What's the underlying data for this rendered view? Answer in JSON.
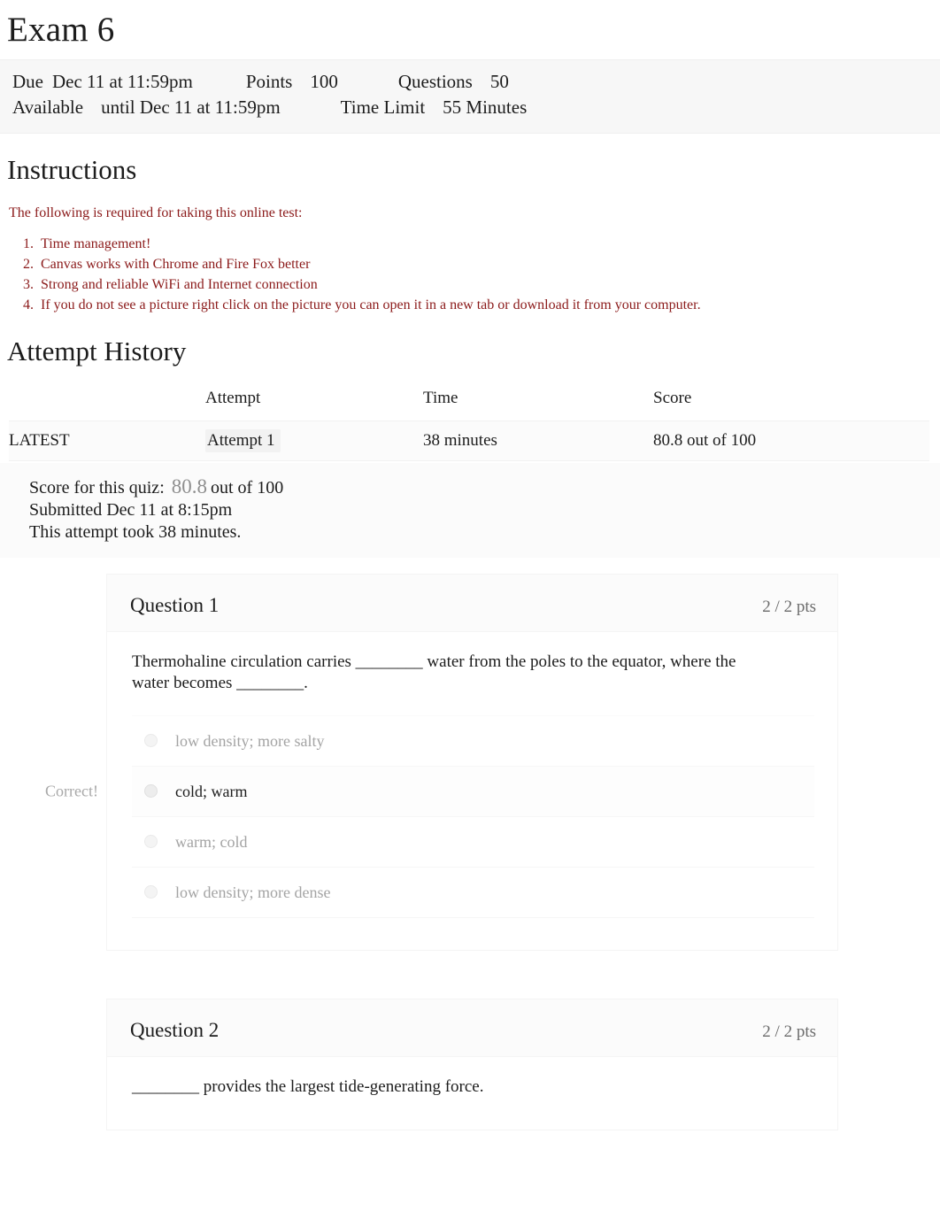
{
  "quiz": {
    "title": "Exam 6",
    "meta": {
      "due_label": "Due",
      "due_value": "Dec 11 at 11:59pm",
      "points_label": "Points",
      "points_value": "100",
      "questions_label": "Questions",
      "questions_value": "50",
      "available_label": "Available",
      "available_value": "until Dec 11 at 11:59pm",
      "time_limit_label": "Time Limit",
      "time_limit_value": "55 Minutes"
    }
  },
  "instructions": {
    "heading": "Instructions",
    "intro": "The following is required for taking this online test:",
    "color": "#8b1a1a",
    "items": [
      "Time management!",
      "Canvas works with Chrome and Fire Fox better",
      "Strong and reliable WiFi and Internet connection",
      "If you do not see a picture right click on the picture you can open it in a new tab or download it from your computer."
    ]
  },
  "attempt_history": {
    "heading": "Attempt History",
    "columns": [
      "",
      "Attempt",
      "Time",
      "Score"
    ],
    "rows": [
      {
        "flag": "LATEST",
        "attempt": "Attempt 1",
        "time": "38 minutes",
        "score": "80.8 out of 100"
      }
    ]
  },
  "score_summary": {
    "score_label": "Score for this quiz:",
    "score_value": "80.8",
    "score_suffix": "out of 100",
    "submitted": "Submitted Dec 11 at 8:15pm",
    "duration": "This attempt took 38 minutes."
  },
  "questions": [
    {
      "name": "Question 1",
      "points": "2 / 2 pts",
      "text": "Thermohaline circulation carries ________ water from the poles to the equator, where the water becomes ________.",
      "answers": [
        {
          "text": "low density; more salty",
          "selected": false,
          "status": ""
        },
        {
          "text": "cold; warm",
          "selected": true,
          "status": "Correct!"
        },
        {
          "text": "warm; cold",
          "selected": false,
          "status": ""
        },
        {
          "text": "low density; more dense",
          "selected": false,
          "status": ""
        }
      ]
    },
    {
      "name": "Question 2",
      "points": "2 / 2 pts",
      "text": "________ provides the largest tide-generating force.",
      "answers": []
    }
  ]
}
